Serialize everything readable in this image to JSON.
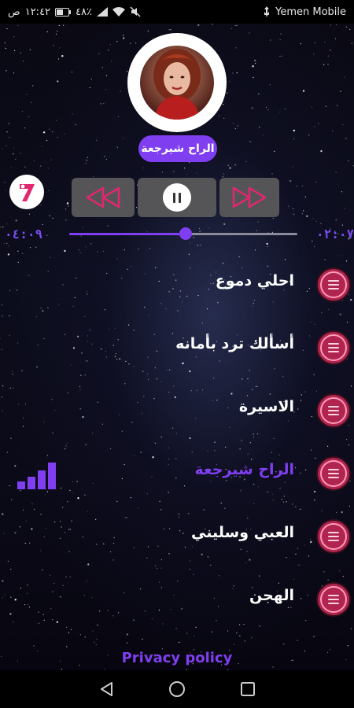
{
  "status_bar": {
    "time": "١٢:٤٢",
    "period": "ص",
    "battery": "٤٨٪",
    "carrier": "Yemen Mobile"
  },
  "player": {
    "now_playing": "الراح شيرجعة",
    "elapsed": "٠٢:٠٧",
    "duration": "٠٤:٠٩",
    "progress": 0.51,
    "state": "playing"
  },
  "app_logo": {
    "glyph": "7"
  },
  "playlist": {
    "items": [
      {
        "title": "احلي دموع",
        "active": false
      },
      {
        "title": "أسألك ترد بأمانه",
        "active": false
      },
      {
        "title": "الاسيرة",
        "active": false
      },
      {
        "title": "الراح شيرجعة",
        "active": true
      },
      {
        "title": "العبي وسليني",
        "active": false
      },
      {
        "title": "الهجن",
        "active": false
      }
    ]
  },
  "footer": {
    "privacy_label": "Privacy policy"
  },
  "colors": {
    "accent": "#7f3ef0",
    "icon_red": "#b0254f",
    "logo_pink": "#e0276f"
  },
  "icons": {
    "prev": "double-left-triangle-icon",
    "pause": "pause-icon",
    "next": "double-right-triangle-icon",
    "track": "menu-lines-icon",
    "playing": "equalizer-icon"
  }
}
